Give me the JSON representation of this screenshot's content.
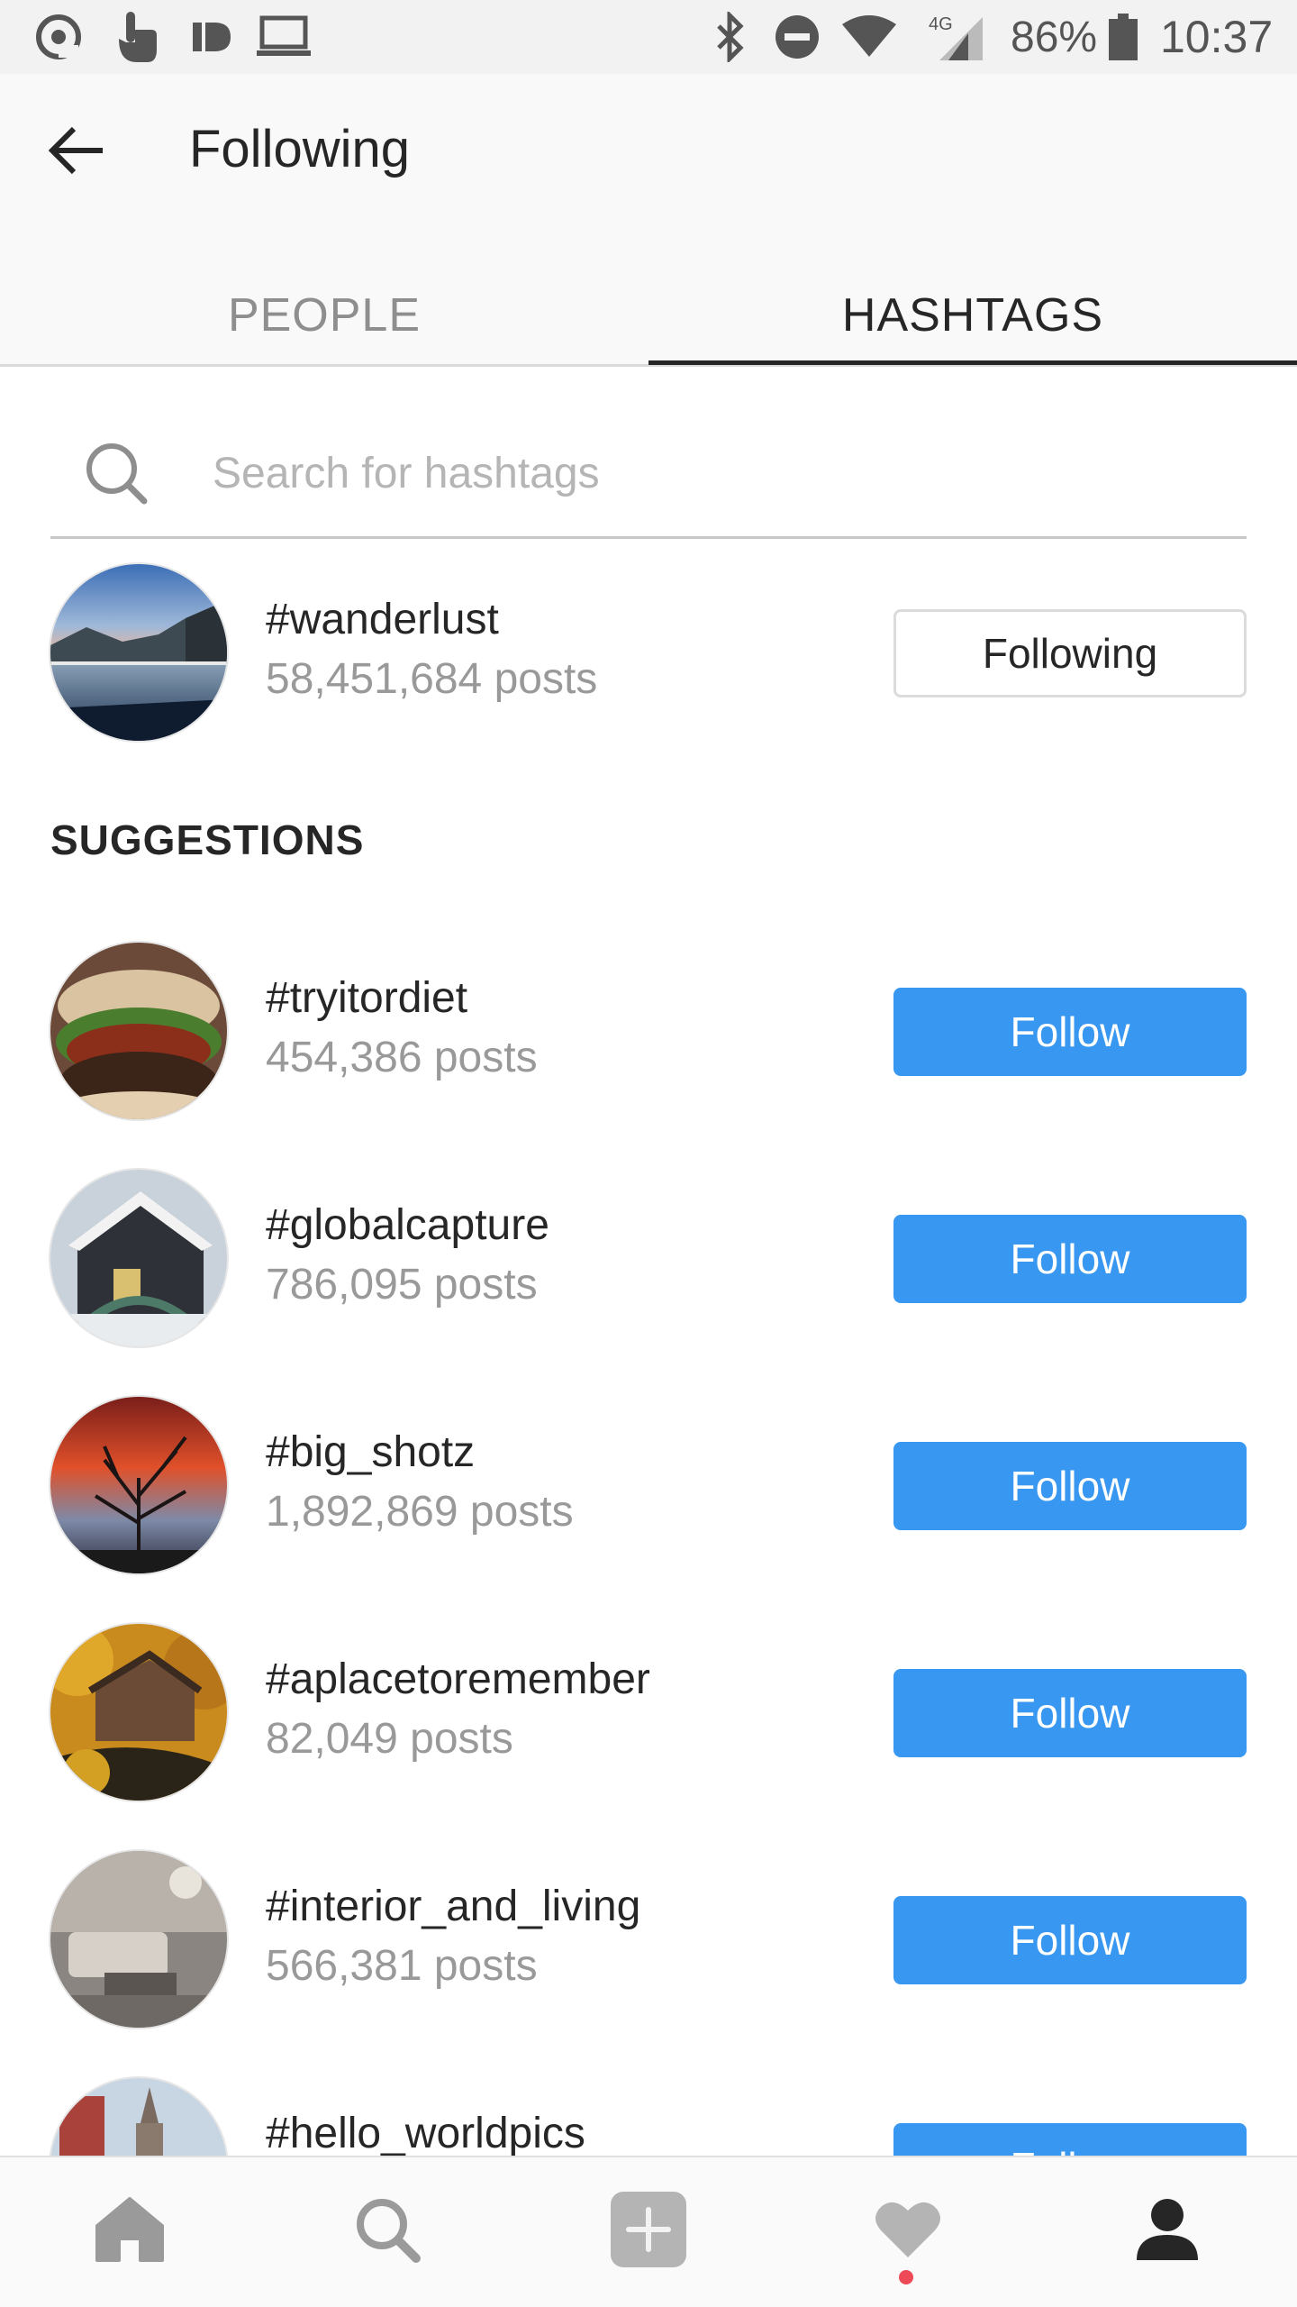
{
  "status_bar": {
    "battery": "86%",
    "time": "10:37",
    "network": "4G"
  },
  "header": {
    "title": "Following",
    "tabs": [
      {
        "label": "PEOPLE",
        "active": false
      },
      {
        "label": "HASHTAGS",
        "active": true
      }
    ]
  },
  "search": {
    "placeholder": "Search for hashtags",
    "value": ""
  },
  "following": [
    {
      "tag": "#wanderlust",
      "posts": "58,451,684 posts",
      "button": "Following"
    }
  ],
  "suggestions": {
    "title": "SUGGESTIONS",
    "items": [
      {
        "tag": "#tryitordiet",
        "posts": "454,386 posts",
        "button": "Follow"
      },
      {
        "tag": "#globalcapture",
        "posts": "786,095 posts",
        "button": "Follow"
      },
      {
        "tag": "#big_shotz",
        "posts": "1,892,869 posts",
        "button": "Follow"
      },
      {
        "tag": "#aplacetoremember",
        "posts": "82,049 posts",
        "button": "Follow"
      },
      {
        "tag": "#interior_and_living",
        "posts": "566,381 posts",
        "button": "Follow"
      },
      {
        "tag": "#hello_worldpics",
        "posts": "",
        "button": "Follow"
      }
    ]
  },
  "bottom_nav": [
    {
      "icon": "home-icon"
    },
    {
      "icon": "search-icon"
    },
    {
      "icon": "add-post-icon"
    },
    {
      "icon": "activity-heart-icon"
    },
    {
      "icon": "profile-icon"
    }
  ],
  "colors": {
    "accent": "#3897f0",
    "notification": "#ed4956"
  }
}
